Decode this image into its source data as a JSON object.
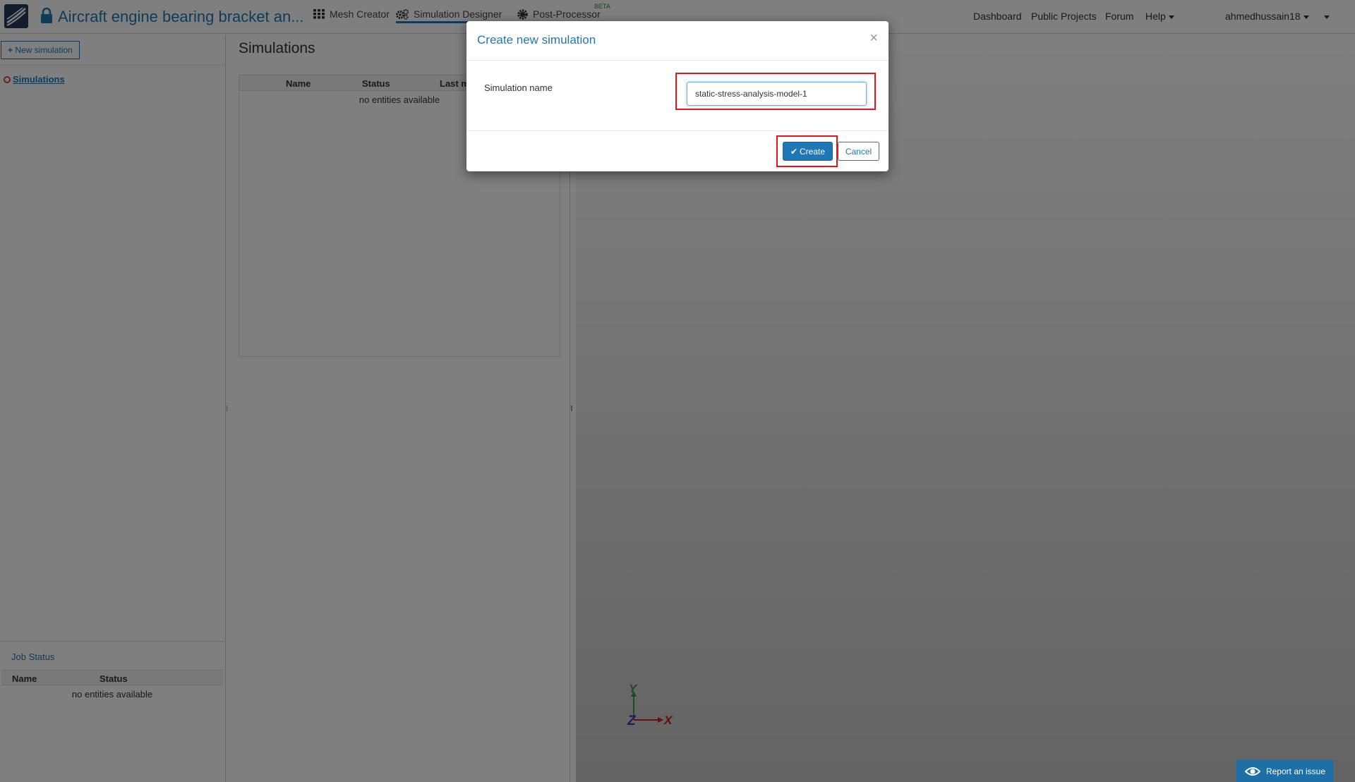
{
  "topbar": {
    "project_title": "Aircraft engine bearing bracket an...",
    "tabs": [
      {
        "label": "Mesh Creator",
        "active": false
      },
      {
        "label": "Simulation Designer",
        "active": true
      },
      {
        "label": "Post-Processor",
        "active": false
      }
    ],
    "beta_badge": "BETA",
    "links": {
      "dashboard": "Dashboard",
      "public_projects": "Public Projects",
      "forum": "Forum",
      "help": "Help"
    },
    "username": "ahmedhussain18"
  },
  "left_panel": {
    "new_button": "New simulation",
    "tree_root": "Simulations",
    "job_status": {
      "title": "Job Status",
      "columns": [
        "Name",
        "Status"
      ],
      "empty_text": "no entities available"
    }
  },
  "center_panel": {
    "title": "Simulations",
    "columns": [
      "Name",
      "Status",
      "Last m"
    ],
    "empty_text": "no entities available"
  },
  "viewer": {
    "axes": {
      "x": "X",
      "y": "Y",
      "z": "Z"
    },
    "report_button": "Report an issue"
  },
  "modal": {
    "title": "Create new simulation",
    "close_glyph": "×",
    "field_label": "Simulation name",
    "field_value": "static-stress-analysis-model-1",
    "create_button": "Create",
    "cancel_button": "Cancel"
  },
  "colors": {
    "accent": "#1d78b5",
    "highlight": "#e8141c",
    "overlay": "rgba(0,0,0,0.5)"
  }
}
